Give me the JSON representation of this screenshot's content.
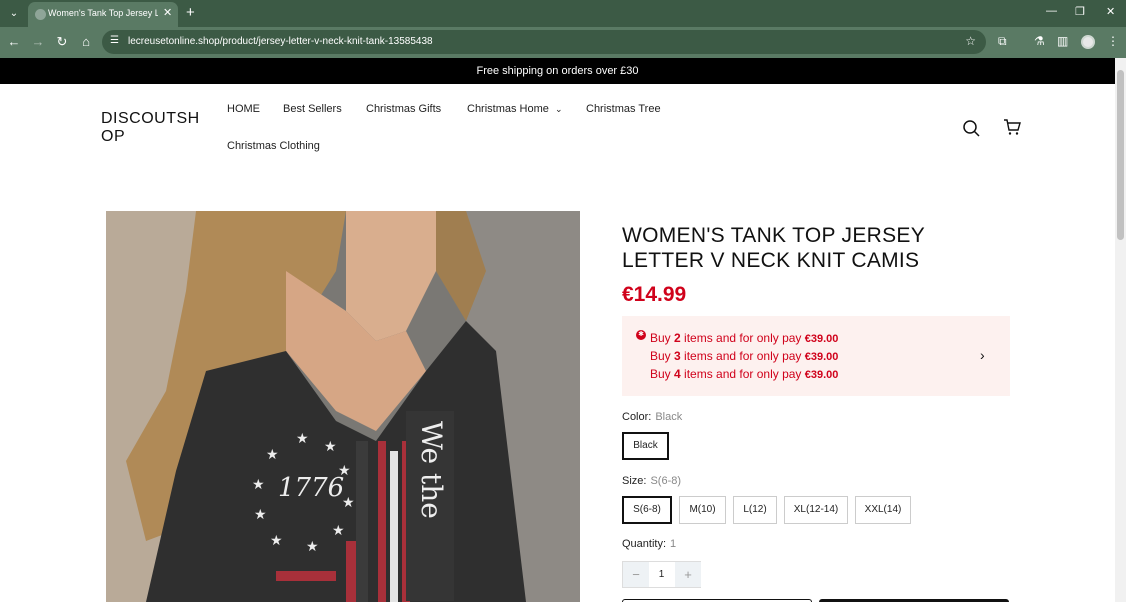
{
  "browser": {
    "tab_title": "Women's Tank Top Jersey Letter V Neck Knit Camis",
    "url": "lecreusetonline.shop/product/jersey-letter-v-neck-knit-tank-13585438"
  },
  "announcement": "Free shipping on orders over £30",
  "header": {
    "logo": "DISCOUTSHOP",
    "nav": [
      "HOME",
      "Best Sellers",
      "Christmas Gifts",
      "Christmas Home",
      "Christmas Tree",
      "Christmas Clothing"
    ]
  },
  "product": {
    "title": "WOMEN'S TANK TOP JERSEY LETTER V NECK KNIT CAMIS",
    "price": "€14.99",
    "promo": [
      {
        "pre": "Buy ",
        "qty": "2",
        "mid": " items and for only pay ",
        "amount": "€39.00"
      },
      {
        "pre": "Buy ",
        "qty": "3",
        "mid": " items and for only pay ",
        "amount": "€39.00"
      },
      {
        "pre": "Buy ",
        "qty": "4",
        "mid": " items and for only pay ",
        "amount": "€39.00"
      }
    ],
    "color_label": "Color:",
    "color_value": "Black",
    "colors": [
      "Black"
    ],
    "size_label": "Size:",
    "size_value": "S(6-8)",
    "sizes": [
      "S(6-8)",
      "M(10)",
      "L(12)",
      "XL(12-14)",
      "XXL(14)"
    ],
    "quantity_label": "Quantity:",
    "quantity_value_display": "1",
    "quantity": "1",
    "image_print": {
      "year": "1776"
    }
  },
  "colors": {
    "accent": "#d0021b",
    "chrome": "#3c5a45",
    "promo_bg": "#fdf1ef"
  }
}
